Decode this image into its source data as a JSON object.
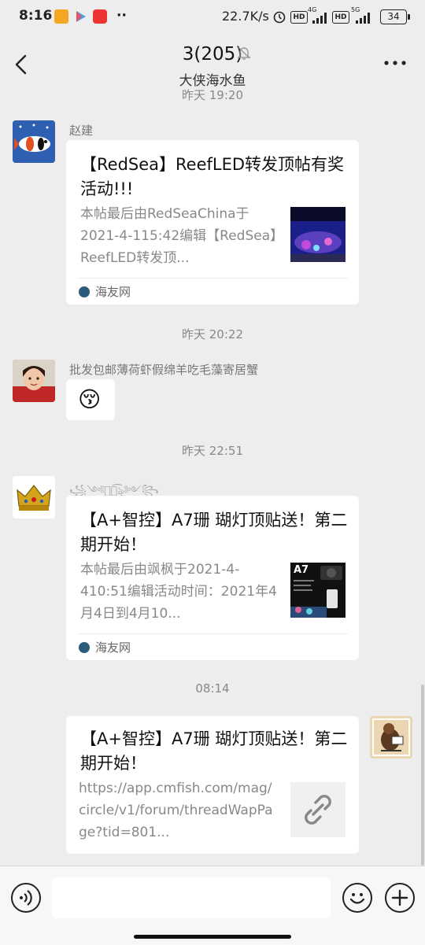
{
  "status_bar": {
    "time": "8:16",
    "network_speed": "22.7K/s",
    "hd_label": "HD",
    "net_4g": "4G",
    "net_5g": "5G",
    "battery": "34"
  },
  "header": {
    "title": "3(205)",
    "subtitle": "大侠海水鱼",
    "back_icon": "chevron-left-icon",
    "more_icon": "more-dots-icon",
    "muted_icon": "bell-off-icon"
  },
  "messages": [
    {
      "timestamp": "昨天 19:20",
      "sender": "赵建",
      "card": {
        "title": "【RedSea】ReefLED转发顶帖有奖活动!!!",
        "description": "本帖最后由RedSeaChina于2021-4-115:42编辑【RedSea】ReefLED转发顶...",
        "source": "海友网"
      }
    },
    {
      "timestamp": "昨天 20:22",
      "sender": "批发包邮薄荷虾假绵羊吃毛藻寄居蟹",
      "emoji": "😚"
    },
    {
      "timestamp": "昨天 22:51",
      "sender": "꧁༺ৡৢ͜͡ৡ༻꧂",
      "card": {
        "title": "【A+智控】A7珊 瑚灯顶贴送！第二期开始！",
        "description": "本帖最后由飒枫于2021-4-410:51编辑活动时间：2021年4月4日到4月10...",
        "source": "海友网",
        "thumb_label": "A7"
      }
    },
    {
      "timestamp": "08:14",
      "card": {
        "title": "【A+智控】A7珊 瑚灯顶贴送！第二期开始！",
        "description": "https://app.cmfish.com/mag/circle/v1/forum/threadWapPage?tid=801...",
        "link_icon": "link-icon"
      }
    }
  ],
  "composer": {
    "voice_icon": "voice-icon",
    "emoji_icon": "emoji-icon",
    "plus_icon": "plus-icon"
  }
}
